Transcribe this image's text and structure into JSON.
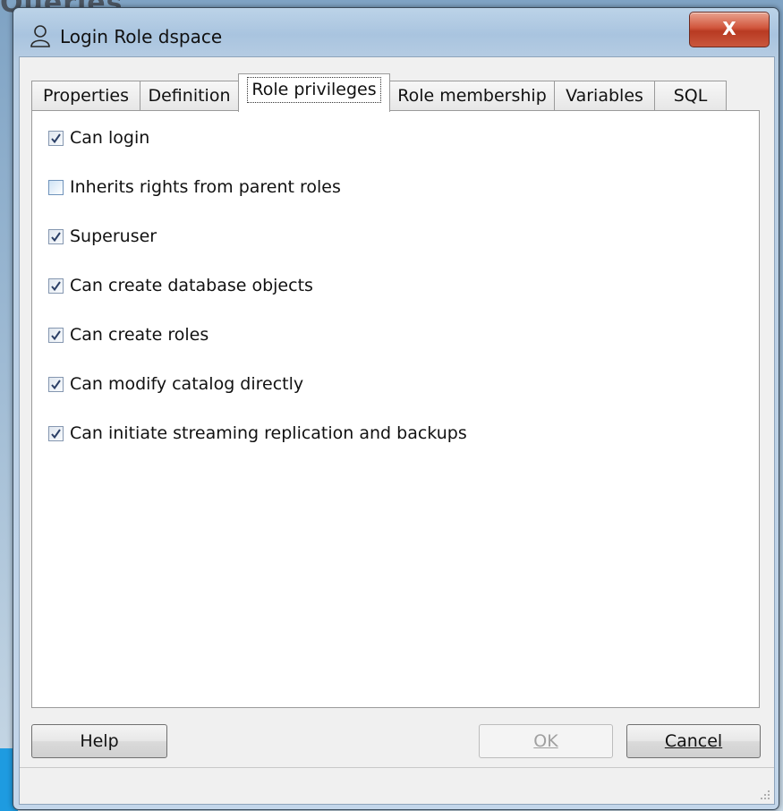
{
  "background": {
    "title_fragment": "Queries"
  },
  "window": {
    "title": "Login Role dspace",
    "close_label": "X"
  },
  "tabs": [
    {
      "label": "Properties",
      "active": false
    },
    {
      "label": "Definition",
      "active": false
    },
    {
      "label": "Role privileges",
      "active": true
    },
    {
      "label": "Role membership",
      "active": false
    },
    {
      "label": "Variables",
      "active": false
    },
    {
      "label": "SQL",
      "active": false
    }
  ],
  "privileges": [
    {
      "label": "Can login",
      "checked": true
    },
    {
      "label": "Inherits rights from parent roles",
      "checked": false
    },
    {
      "label": "Superuser",
      "checked": true
    },
    {
      "label": "Can create database objects",
      "checked": true
    },
    {
      "label": "Can create roles",
      "checked": true
    },
    {
      "label": "Can modify catalog directly",
      "checked": true
    },
    {
      "label": "Can initiate streaming replication and backups",
      "checked": true
    }
  ],
  "buttons": {
    "help": "Help",
    "ok": "OK",
    "cancel": "Cancel"
  },
  "colors": {
    "close_button": "#c9573d",
    "checkbox_border": "#8597b0",
    "check_mark": "#2b3f66"
  }
}
